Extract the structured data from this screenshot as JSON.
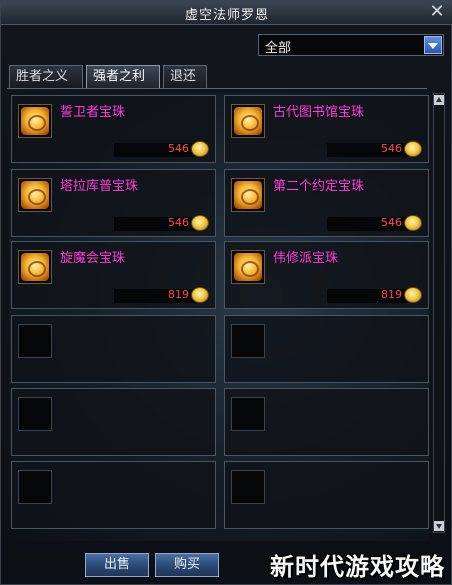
{
  "window": {
    "title": "虚空法师罗恩",
    "close_label": "✕"
  },
  "filter": {
    "value": "全部"
  },
  "tabs": [
    {
      "label": "胜者之义",
      "active": false
    },
    {
      "label": "强者之利",
      "active": true
    },
    {
      "label": "退还",
      "active": false
    }
  ],
  "items": [
    {
      "name": "誓卫者宝珠",
      "price": "546"
    },
    {
      "name": "古代图书馆宝珠",
      "price": "546"
    },
    {
      "name": "塔拉库普宝珠",
      "price": "546"
    },
    {
      "name": "第二个约定宝珠",
      "price": "546"
    },
    {
      "name": "旋魔会宝珠",
      "price": "819"
    },
    {
      "name": "伟修派宝珠",
      "price": "819"
    }
  ],
  "empty_slots": 6,
  "buttons": {
    "sell": "出售",
    "buy": "购买"
  },
  "watermark": "新时代游戏攻略",
  "colors": {
    "item_name": "#ff3cd6",
    "price": "#ff4a4a",
    "accent_blue": "#2c4c7a"
  }
}
